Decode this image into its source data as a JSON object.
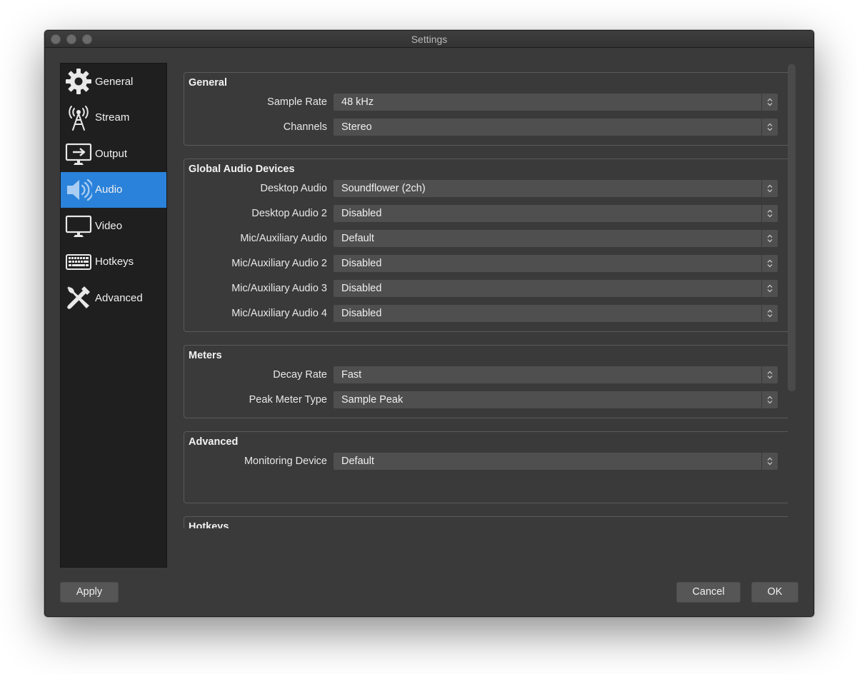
{
  "window": {
    "title": "Settings"
  },
  "sidebar": {
    "items": [
      {
        "label": "General",
        "icon": "gear-icon",
        "active": false
      },
      {
        "label": "Stream",
        "icon": "broadcast-tower-icon",
        "active": false
      },
      {
        "label": "Output",
        "icon": "monitor-output-icon",
        "active": false
      },
      {
        "label": "Audio",
        "icon": "speaker-icon",
        "active": true
      },
      {
        "label": "Video",
        "icon": "monitor-icon",
        "active": false
      },
      {
        "label": "Hotkeys",
        "icon": "keyboard-icon",
        "active": false
      },
      {
        "label": "Advanced",
        "icon": "tools-icon",
        "active": false
      }
    ]
  },
  "groups": {
    "general": {
      "title": "General",
      "rows": [
        {
          "label": "Sample Rate",
          "value": "48 kHz"
        },
        {
          "label": "Channels",
          "value": "Stereo"
        }
      ]
    },
    "global_audio": {
      "title": "Global Audio Devices",
      "rows": [
        {
          "label": "Desktop Audio",
          "value": "Soundflower (2ch)"
        },
        {
          "label": "Desktop Audio 2",
          "value": "Disabled"
        },
        {
          "label": "Mic/Auxiliary Audio",
          "value": "Default"
        },
        {
          "label": "Mic/Auxiliary Audio 2",
          "value": "Disabled"
        },
        {
          "label": "Mic/Auxiliary Audio 3",
          "value": "Disabled"
        },
        {
          "label": "Mic/Auxiliary Audio 4",
          "value": "Disabled"
        }
      ]
    },
    "meters": {
      "title": "Meters",
      "rows": [
        {
          "label": "Decay Rate",
          "value": "Fast"
        },
        {
          "label": "Peak Meter Type",
          "value": "Sample Peak"
        }
      ]
    },
    "advanced": {
      "title": "Advanced",
      "rows": [
        {
          "label": "Monitoring Device",
          "value": "Default"
        }
      ]
    },
    "hotkeys": {
      "title": "Hotkeys"
    }
  },
  "buttons": {
    "apply": "Apply",
    "cancel": "Cancel",
    "ok": "OK"
  },
  "colors": {
    "accent": "#2a82da",
    "window_bg": "#3a3a3a",
    "sidebar_bg": "#1f1f1f",
    "select_bg": "#4f4f4f"
  }
}
